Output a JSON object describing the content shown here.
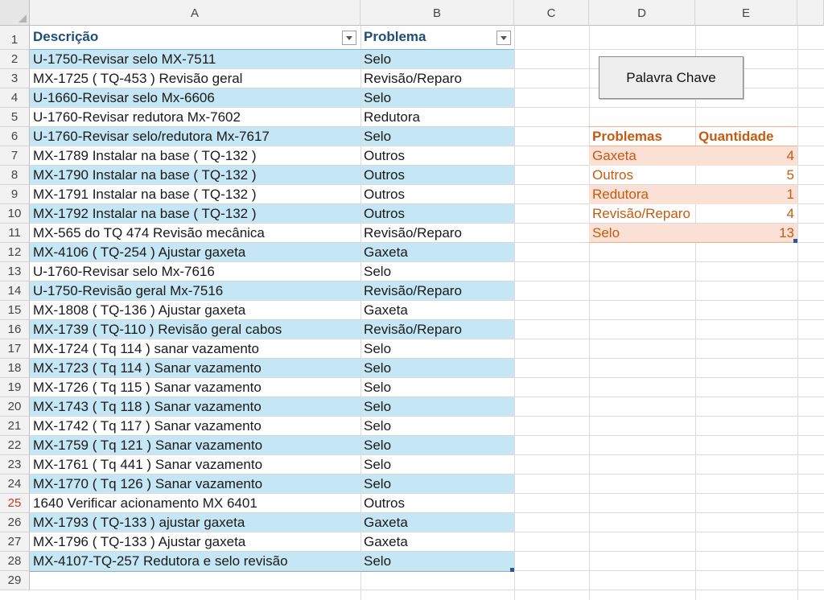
{
  "columns": [
    "A",
    "B",
    "C",
    "D",
    "E"
  ],
  "rows": [
    "1",
    "2",
    "3",
    "4",
    "5",
    "6",
    "7",
    "8",
    "9",
    "10",
    "11",
    "12",
    "13",
    "14",
    "15",
    "16",
    "17",
    "18",
    "19",
    "20",
    "21",
    "22",
    "23",
    "24",
    "25",
    "26",
    "27",
    "28",
    "29"
  ],
  "table": {
    "headers": {
      "descricao": "Descrição",
      "problema": "Problema"
    },
    "rows": [
      {
        "descricao": "U-1750-Revisar selo MX-7511",
        "problema": "Selo"
      },
      {
        "descricao": "MX-1725   ( TQ-453 )    Revisão geral",
        "problema": "Revisão/Reparo"
      },
      {
        "descricao": "U-1660-Revisar selo Mx-6606",
        "problema": "Selo"
      },
      {
        "descricao": "U-1760-Revisar redutora Mx-7602",
        "problema": "Redutora"
      },
      {
        "descricao": "U-1760-Revisar selo/redutora Mx-7617",
        "problema": "Selo"
      },
      {
        "descricao": "MX-1789  Instalar na base ( TQ-132 )",
        "problema": "Outros"
      },
      {
        "descricao": "MX-1790  Instalar  na  base  ( TQ-132 )",
        "problema": "Outros"
      },
      {
        "descricao": "MX-1791 Instalar na base  ( TQ-132 )",
        "problema": "Outros"
      },
      {
        "descricao": "MX-1792  Instalar  na base  ( TQ-132 )",
        "problema": "Outros"
      },
      {
        "descricao": "MX-565 do TQ 474 Revisão mecânica",
        "problema": "Revisão/Reparo"
      },
      {
        "descricao": "MX-4106  ( TQ-254 )  Ajustar  gaxeta",
        "problema": "Gaxeta"
      },
      {
        "descricao": "U-1760-Revisar selo Mx-7616",
        "problema": "Selo"
      },
      {
        "descricao": "U-1750-Revisão geral Mx-7516",
        "problema": "Revisão/Reparo"
      },
      {
        "descricao": "MX-1808  ( TQ-136 )  Ajustar  gaxeta",
        "problema": "Gaxeta"
      },
      {
        "descricao": "MX-1739  ( TQ-110 ) Revisão geral  cabos",
        "problema": "Revisão/Reparo"
      },
      {
        "descricao": "MX-1724   ( Tq  114 )  sanar  vazamento",
        "problema": "Selo"
      },
      {
        "descricao": "MX-1723  ( Tq 114 )  Sanar  vazamento",
        "problema": "Selo"
      },
      {
        "descricao": "MX-1726  ( Tq 115 )  Sanar  vazamento",
        "problema": "Selo"
      },
      {
        "descricao": "MX-1743 ( Tq 118 )  Sanar  vazamento",
        "problema": "Selo"
      },
      {
        "descricao": "MX-1742  ( Tq 117 )  Sanar  vazamento",
        "problema": "Selo"
      },
      {
        "descricao": "MX-1759  ( Tq 121 )  Sanar  vazamento",
        "problema": "Selo"
      },
      {
        "descricao": "MX-1761 ( Tq 441 )  Sanar  vazamento",
        "problema": "Selo"
      },
      {
        "descricao": "MX-1770  ( Tq 126 )  Sanar  vazamento",
        "problema": "Selo"
      },
      {
        "descricao": "1640 Verificar acionamento MX 6401",
        "problema": "Outros"
      },
      {
        "descricao": "MX-1793  ( TQ-133 )  ajustar  gaxeta",
        "problema": "Gaxeta"
      },
      {
        "descricao": "MX-1796  ( TQ-133 )  Ajustar  gaxeta",
        "problema": "Gaxeta"
      },
      {
        "descricao": "MX-4107-TQ-257 Redutora e selo revisão",
        "problema": "Selo"
      }
    ]
  },
  "button": {
    "label": "Palavra Chave"
  },
  "summary": {
    "headers": {
      "problemas": "Problemas",
      "quantidade": "Quantidade"
    },
    "rows": [
      {
        "problema": "Gaxeta",
        "quantidade": "4"
      },
      {
        "problema": "Outros",
        "quantidade": "5"
      },
      {
        "problema": "Redutora",
        "quantidade": "1"
      },
      {
        "problema": "Revisão/Reparo",
        "quantidade": "4"
      },
      {
        "problema": "Selo",
        "quantidade": "13"
      }
    ]
  },
  "colors": {
    "table_band": "#c4e6f5",
    "table_header_text": "#1f4e79",
    "summary_band": "#fbe0d5",
    "summary_text": "#c55a11"
  }
}
